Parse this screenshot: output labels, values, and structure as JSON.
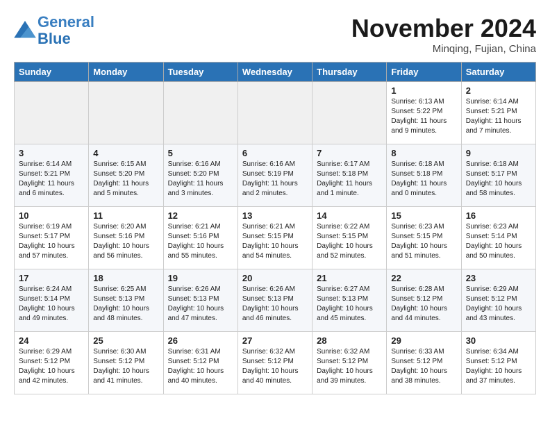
{
  "header": {
    "logo_line1": "General",
    "logo_line2": "Blue",
    "month_title": "November 2024",
    "location": "Minqing, Fujian, China"
  },
  "days_of_week": [
    "Sunday",
    "Monday",
    "Tuesday",
    "Wednesday",
    "Thursday",
    "Friday",
    "Saturday"
  ],
  "weeks": [
    [
      {
        "day": "",
        "info": ""
      },
      {
        "day": "",
        "info": ""
      },
      {
        "day": "",
        "info": ""
      },
      {
        "day": "",
        "info": ""
      },
      {
        "day": "",
        "info": ""
      },
      {
        "day": "1",
        "info": "Sunrise: 6:13 AM\nSunset: 5:22 PM\nDaylight: 11 hours and 9 minutes."
      },
      {
        "day": "2",
        "info": "Sunrise: 6:14 AM\nSunset: 5:21 PM\nDaylight: 11 hours and 7 minutes."
      }
    ],
    [
      {
        "day": "3",
        "info": "Sunrise: 6:14 AM\nSunset: 5:21 PM\nDaylight: 11 hours and 6 minutes."
      },
      {
        "day": "4",
        "info": "Sunrise: 6:15 AM\nSunset: 5:20 PM\nDaylight: 11 hours and 5 minutes."
      },
      {
        "day": "5",
        "info": "Sunrise: 6:16 AM\nSunset: 5:20 PM\nDaylight: 11 hours and 3 minutes."
      },
      {
        "day": "6",
        "info": "Sunrise: 6:16 AM\nSunset: 5:19 PM\nDaylight: 11 hours and 2 minutes."
      },
      {
        "day": "7",
        "info": "Sunrise: 6:17 AM\nSunset: 5:18 PM\nDaylight: 11 hours and 1 minute."
      },
      {
        "day": "8",
        "info": "Sunrise: 6:18 AM\nSunset: 5:18 PM\nDaylight: 11 hours and 0 minutes."
      },
      {
        "day": "9",
        "info": "Sunrise: 6:18 AM\nSunset: 5:17 PM\nDaylight: 10 hours and 58 minutes."
      }
    ],
    [
      {
        "day": "10",
        "info": "Sunrise: 6:19 AM\nSunset: 5:17 PM\nDaylight: 10 hours and 57 minutes."
      },
      {
        "day": "11",
        "info": "Sunrise: 6:20 AM\nSunset: 5:16 PM\nDaylight: 10 hours and 56 minutes."
      },
      {
        "day": "12",
        "info": "Sunrise: 6:21 AM\nSunset: 5:16 PM\nDaylight: 10 hours and 55 minutes."
      },
      {
        "day": "13",
        "info": "Sunrise: 6:21 AM\nSunset: 5:15 PM\nDaylight: 10 hours and 54 minutes."
      },
      {
        "day": "14",
        "info": "Sunrise: 6:22 AM\nSunset: 5:15 PM\nDaylight: 10 hours and 52 minutes."
      },
      {
        "day": "15",
        "info": "Sunrise: 6:23 AM\nSunset: 5:15 PM\nDaylight: 10 hours and 51 minutes."
      },
      {
        "day": "16",
        "info": "Sunrise: 6:23 AM\nSunset: 5:14 PM\nDaylight: 10 hours and 50 minutes."
      }
    ],
    [
      {
        "day": "17",
        "info": "Sunrise: 6:24 AM\nSunset: 5:14 PM\nDaylight: 10 hours and 49 minutes."
      },
      {
        "day": "18",
        "info": "Sunrise: 6:25 AM\nSunset: 5:13 PM\nDaylight: 10 hours and 48 minutes."
      },
      {
        "day": "19",
        "info": "Sunrise: 6:26 AM\nSunset: 5:13 PM\nDaylight: 10 hours and 47 minutes."
      },
      {
        "day": "20",
        "info": "Sunrise: 6:26 AM\nSunset: 5:13 PM\nDaylight: 10 hours and 46 minutes."
      },
      {
        "day": "21",
        "info": "Sunrise: 6:27 AM\nSunset: 5:13 PM\nDaylight: 10 hours and 45 minutes."
      },
      {
        "day": "22",
        "info": "Sunrise: 6:28 AM\nSunset: 5:12 PM\nDaylight: 10 hours and 44 minutes."
      },
      {
        "day": "23",
        "info": "Sunrise: 6:29 AM\nSunset: 5:12 PM\nDaylight: 10 hours and 43 minutes."
      }
    ],
    [
      {
        "day": "24",
        "info": "Sunrise: 6:29 AM\nSunset: 5:12 PM\nDaylight: 10 hours and 42 minutes."
      },
      {
        "day": "25",
        "info": "Sunrise: 6:30 AM\nSunset: 5:12 PM\nDaylight: 10 hours and 41 minutes."
      },
      {
        "day": "26",
        "info": "Sunrise: 6:31 AM\nSunset: 5:12 PM\nDaylight: 10 hours and 40 minutes."
      },
      {
        "day": "27",
        "info": "Sunrise: 6:32 AM\nSunset: 5:12 PM\nDaylight: 10 hours and 40 minutes."
      },
      {
        "day": "28",
        "info": "Sunrise: 6:32 AM\nSunset: 5:12 PM\nDaylight: 10 hours and 39 minutes."
      },
      {
        "day": "29",
        "info": "Sunrise: 6:33 AM\nSunset: 5:12 PM\nDaylight: 10 hours and 38 minutes."
      },
      {
        "day": "30",
        "info": "Sunrise: 6:34 AM\nSunset: 5:12 PM\nDaylight: 10 hours and 37 minutes."
      }
    ]
  ]
}
